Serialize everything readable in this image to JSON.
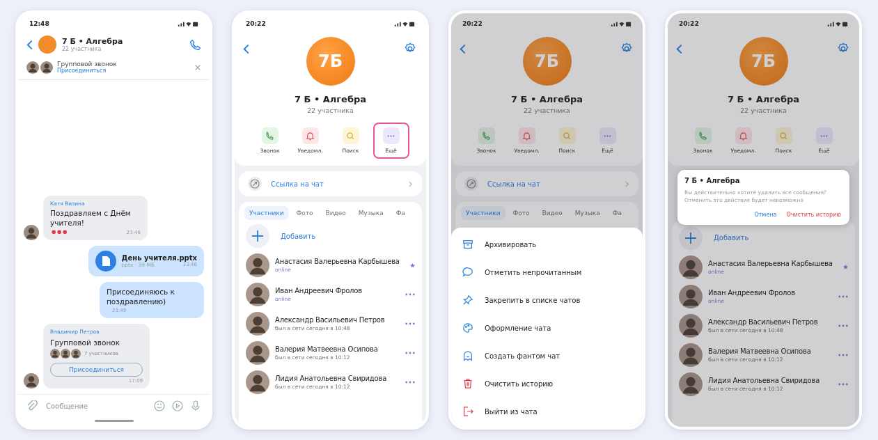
{
  "screens": [
    {
      "kind": "chat",
      "time": "12:48",
      "title": "7 Б • Алгебра",
      "subtitle": "22 участника",
      "call_banner": {
        "title": "Групповой звонок",
        "action": "Присоединиться"
      },
      "messages": [
        {
          "kind": "text",
          "outgoing": false,
          "author": "Катя Визина",
          "text": "Поздравляем с Днём учителя!",
          "balloons": true,
          "time": "23:46"
        },
        {
          "kind": "file",
          "outgoing": true,
          "file_name": "День учителя.pptx",
          "file_info": "pptx · 39 МБ",
          "time": "23:46"
        },
        {
          "kind": "text",
          "outgoing": true,
          "text": "Присоединяюсь к поздравлению)",
          "balloons": false,
          "time": "23:49"
        },
        {
          "kind": "call",
          "outgoing": false,
          "author": "Владимир Петров",
          "title": "Групповой звонок",
          "participants": "7 участников",
          "action": "Присоединиться",
          "time": "17:09"
        }
      ],
      "composer": {
        "placeholder": "Сообщение"
      }
    },
    {
      "kind": "profile",
      "dimmed": false,
      "time": "20:22",
      "avatar": "7Б",
      "title": "7 Б • Алгебра",
      "subtitle": "22 участника",
      "actions": [
        {
          "kind": "call",
          "label": "Звонок",
          "selected": false
        },
        {
          "kind": "bell",
          "label": "Уведомл.",
          "selected": false
        },
        {
          "kind": "search",
          "label": "Поиск",
          "selected": false
        },
        {
          "kind": "more",
          "label": "Ещё",
          "selected": true
        }
      ],
      "link": {
        "label": "Ссылка на чат"
      },
      "tabs": [
        {
          "label": "Участники",
          "selected": true
        },
        {
          "label": "Фото",
          "selected": false
        },
        {
          "label": "Видео",
          "selected": false
        },
        {
          "label": "Музыка",
          "selected": false
        },
        {
          "label": "Фа",
          "selected": false
        }
      ],
      "add_label": "Добавить",
      "members": [
        {
          "name": "Анастасия Валерьевна Карбышева",
          "status": "online",
          "online": true,
          "kind": "admin"
        },
        {
          "name": "Иван Андреевич Фролов",
          "status": "online",
          "online": true,
          "kind": "member"
        },
        {
          "name": "Александр Васильевич Петров",
          "status": "был в сети сегодня в 10:48",
          "online": false,
          "kind": "member"
        },
        {
          "name": "Валерия Матвеевна Осипова",
          "status": "был в сети сегодня в 10:12",
          "online": false,
          "kind": "member"
        },
        {
          "name": "Лидия Анатольевна Свиридова",
          "status": "был в сети сегодня в 10:12",
          "online": false,
          "kind": "member"
        }
      ]
    },
    {
      "kind": "profile",
      "dimmed": true,
      "time": "20:22",
      "avatar": "7Б",
      "title": "7 Б • Алгебра",
      "subtitle": "22 участника",
      "actions": [
        {
          "kind": "call",
          "label": "Звонок",
          "selected": false
        },
        {
          "kind": "bell",
          "label": "Уведомл.",
          "selected": false
        },
        {
          "kind": "search",
          "label": "Поиск",
          "selected": false
        },
        {
          "kind": "more",
          "label": "Ещё",
          "selected": false
        }
      ],
      "link": {
        "label": "Ссылка на чат"
      },
      "tabs": [
        {
          "label": "Участники",
          "selected": true
        },
        {
          "label": "Фото",
          "selected": false
        },
        {
          "label": "Видео",
          "selected": false
        },
        {
          "label": "Музыка",
          "selected": false
        },
        {
          "label": "Фа",
          "selected": false
        }
      ],
      "menu": [
        {
          "kind": "archive",
          "label": "Архивировать",
          "danger": false
        },
        {
          "kind": "unread",
          "label": "Отметить непрочитанным",
          "danger": false
        },
        {
          "kind": "pin",
          "label": "Закрепить в списке чатов",
          "danger": false
        },
        {
          "kind": "palette",
          "label": "Оформление чата",
          "danger": false
        },
        {
          "kind": "phantom",
          "label": "Создать фантом чат",
          "danger": false
        },
        {
          "kind": "trash",
          "label": "Очистить историю",
          "danger": true
        },
        {
          "kind": "exit",
          "label": "Выйти из чата",
          "danger": true
        }
      ]
    },
    {
      "kind": "profile",
      "dimmed": true,
      "time": "20:22",
      "avatar": "7Б",
      "title": "7 Б • Алгебра",
      "subtitle": "22 участника",
      "actions": [
        {
          "kind": "call",
          "label": "Звонок",
          "selected": false
        },
        {
          "kind": "bell",
          "label": "Уведомл.",
          "selected": false
        },
        {
          "kind": "search",
          "label": "Поиск",
          "selected": false
        },
        {
          "kind": "more",
          "label": "Ещё",
          "selected": false
        }
      ],
      "dialog": {
        "title": "7 Б • Алгебра",
        "text": "Вы действительно хотите удалить все сообщения? Отменить это действие будет невозможно",
        "cancel": "Отмена",
        "confirm": "Очистить историю"
      },
      "add_label": "Добавить",
      "members": [
        {
          "name": "Анастасия Валерьевна Карбышева",
          "status": "online",
          "online": true,
          "kind": "admin"
        },
        {
          "name": "Иван Андреевич Фролов",
          "status": "online",
          "online": true,
          "kind": "member"
        },
        {
          "name": "Александр Васильевич Петров",
          "status": "был в сети сегодня в 10:48",
          "online": false,
          "kind": "member"
        },
        {
          "name": "Валерия Матвеевна Осипова",
          "status": "был в сети сегодня в 10:12",
          "online": false,
          "kind": "member"
        },
        {
          "name": "Лидия Анатольевна Свиридова",
          "status": "был в сети сегодня в 10:12",
          "online": false,
          "kind": "member"
        }
      ]
    }
  ]
}
